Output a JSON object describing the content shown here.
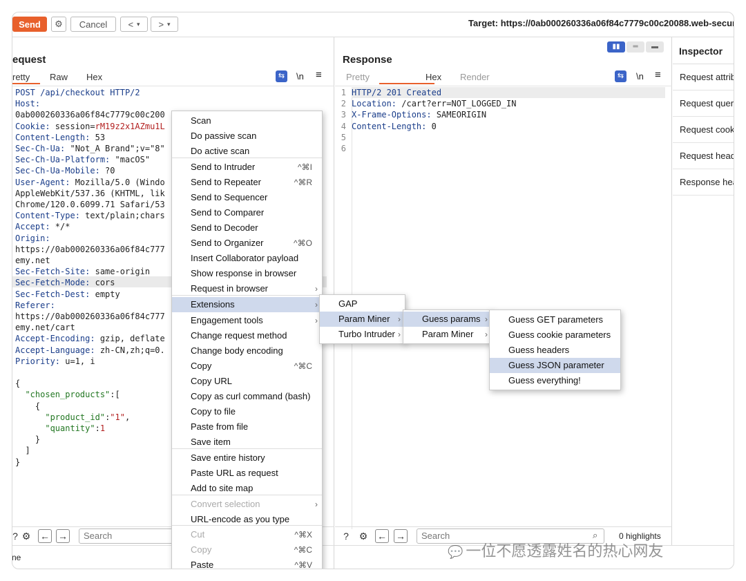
{
  "toolbar": {
    "send": "Send",
    "cancel": "Cancel",
    "back": "<",
    "back_menu": "▾",
    "fwd": ">",
    "fwd_menu": "▾",
    "target": "Target: https://0ab000260336a06f84c7779c00c20088.web-security-"
  },
  "request": {
    "title": "equest",
    "tabs": [
      "retty",
      "Raw",
      "Hex"
    ],
    "newline": "\\n",
    "search_placeholder": "Search",
    "status": "ne",
    "lines": [
      {
        "k": "POST /api/checkout HTTP/2",
        "v": ""
      },
      {
        "k": "Host:",
        "v": ""
      },
      {
        "k": "",
        "v": "0ab000260336a06f84c7779c00c200"
      },
      {
        "k": "Cookie:",
        "v": " session=",
        "r": "rM19z2x1AZmu1L"
      },
      {
        "k": "Content-Length:",
        "v": " 53"
      },
      {
        "k": "Sec-Ch-Ua:",
        "v": " \"Not_A Brand\";v=\"8\""
      },
      {
        "k": "Sec-Ch-Ua-Platform:",
        "v": " \"macOS\""
      },
      {
        "k": "Sec-Ch-Ua-Mobile:",
        "v": " ?0"
      },
      {
        "k": "User-Agent:",
        "v": " Mozilla/5.0 (Windo"
      },
      {
        "k": "",
        "v": "AppleWebKit/537.36 (KHTML, lik"
      },
      {
        "k": "",
        "v": "Chrome/120.0.6099.71 Safari/53"
      },
      {
        "k": "Content-Type:",
        "v": " text/plain;chars"
      },
      {
        "k": "Accept:",
        "v": " */*"
      },
      {
        "k": "Origin:",
        "v": ""
      },
      {
        "k": "",
        "v": "https://0ab000260336a06f84c777"
      },
      {
        "k": "",
        "v": "emy.net"
      },
      {
        "k": "Sec-Fetch-Site:",
        "v": " same-origin"
      },
      {
        "k": "Sec-Fetch-Mode:",
        "v": " cors"
      },
      {
        "k": "Sec-Fetch-Dest:",
        "v": " empty"
      },
      {
        "k": "Referer:",
        "v": ""
      },
      {
        "k": "",
        "v": "https://0ab000260336a06f84c777"
      },
      {
        "k": "",
        "v": "emy.net/cart"
      },
      {
        "k": "Accept-Encoding:",
        "v": " gzip, deflate"
      },
      {
        "k": "Accept-Language:",
        "v": " zh-CN,zh;q=0."
      },
      {
        "k": "Priority:",
        "v": " u=1, i"
      },
      {
        "k": "",
        "v": ""
      },
      {
        "k": "",
        "v": "{"
      },
      {
        "k": "",
        "v": "  ",
        "s": "\"chosen_products\"",
        "t": ":["
      },
      {
        "k": "",
        "v": "    {"
      },
      {
        "k": "",
        "v": "      ",
        "s": "\"product_id\"",
        "t": ":",
        "r": "\"1\"",
        "u": ","
      },
      {
        "k": "",
        "v": "      ",
        "s": "\"quantity\"",
        "t": ":",
        "r": "1"
      },
      {
        "k": "",
        "v": "    }"
      },
      {
        "k": "",
        "v": "  ]"
      },
      {
        "k": "",
        "v": "}"
      }
    ]
  },
  "response": {
    "title": "Response",
    "tabs": [
      "Pretty",
      "Hex",
      "Render"
    ],
    "newline": "\\n",
    "search_placeholder": "Search",
    "highlights": "0 highlights",
    "lines": [
      {
        "n": "1",
        "k": "HTTP/2 201 Created",
        "v": ""
      },
      {
        "n": "2",
        "k": "Location:",
        "v": " /cart?err=NOT_LOGGED_IN"
      },
      {
        "n": "3",
        "k": "X-Frame-Options:",
        "v": " SAMEORIGIN"
      },
      {
        "n": "4",
        "k": "Content-Length:",
        "v": " 0"
      },
      {
        "n": "5",
        "k": "",
        "v": ""
      },
      {
        "n": "6",
        "k": "",
        "v": ""
      }
    ]
  },
  "inspector": {
    "title": "Inspector",
    "items": [
      "Request attrib",
      "Request query",
      "Request cooki",
      "Request heade",
      "Response hea"
    ]
  },
  "context_menu": {
    "items": [
      {
        "label": "Scan",
        "sc": ""
      },
      {
        "label": "Do passive scan",
        "sc": ""
      },
      {
        "label": "Do active scan",
        "sc": ""
      },
      {
        "label": "Send to Intruder",
        "sc": "^⌘I"
      },
      {
        "label": "Send to Repeater",
        "sc": "^⌘R"
      },
      {
        "label": "Send to Sequencer",
        "sc": ""
      },
      {
        "label": "Send to Comparer",
        "sc": ""
      },
      {
        "label": "Send to Decoder",
        "sc": ""
      },
      {
        "label": "Send to Organizer",
        "sc": "^⌘O"
      },
      {
        "label": "Insert Collaborator payload",
        "sc": ""
      },
      {
        "label": "Show response in browser",
        "sc": ""
      },
      {
        "label": "Request in browser",
        "sc": "›"
      },
      {
        "label": "Extensions",
        "sc": "›"
      },
      {
        "label": "Engagement tools",
        "sc": "›"
      },
      {
        "label": "Change request method",
        "sc": ""
      },
      {
        "label": "Change body encoding",
        "sc": ""
      },
      {
        "label": "Copy",
        "sc": "^⌘C"
      },
      {
        "label": "Copy URL",
        "sc": ""
      },
      {
        "label": "Copy as curl command (bash)",
        "sc": ""
      },
      {
        "label": "Copy to file",
        "sc": ""
      },
      {
        "label": "Paste from file",
        "sc": ""
      },
      {
        "label": "Save item",
        "sc": ""
      },
      {
        "label": "Save entire history",
        "sc": ""
      },
      {
        "label": "Paste URL as request",
        "sc": ""
      },
      {
        "label": "Add to site map",
        "sc": ""
      },
      {
        "label": "Convert selection",
        "sc": "›"
      },
      {
        "label": "URL-encode as you type",
        "sc": ""
      },
      {
        "label": "Cut",
        "sc": "^⌘X"
      },
      {
        "label": "Copy",
        "sc": "^⌘C"
      },
      {
        "label": "Paste",
        "sc": "^⌘V"
      }
    ]
  },
  "ext_menu": {
    "items": [
      "GAP",
      "Param Miner",
      "Turbo Intruder"
    ]
  },
  "param_menu": {
    "items": [
      "Guess params",
      "Param Miner"
    ]
  },
  "guess_menu": {
    "items": [
      "Guess GET parameters",
      "Guess cookie parameters",
      "Guess headers",
      "Guess JSON parameter",
      "Guess everything!"
    ]
  },
  "watermark": "一位不愿透露姓名的热心网友",
  "colors": {
    "accent": "#e8602c",
    "menu_selected": "#cfd9ec",
    "key": "#1a3d8a",
    "string": "#227722",
    "literal": "#b21f1f"
  }
}
